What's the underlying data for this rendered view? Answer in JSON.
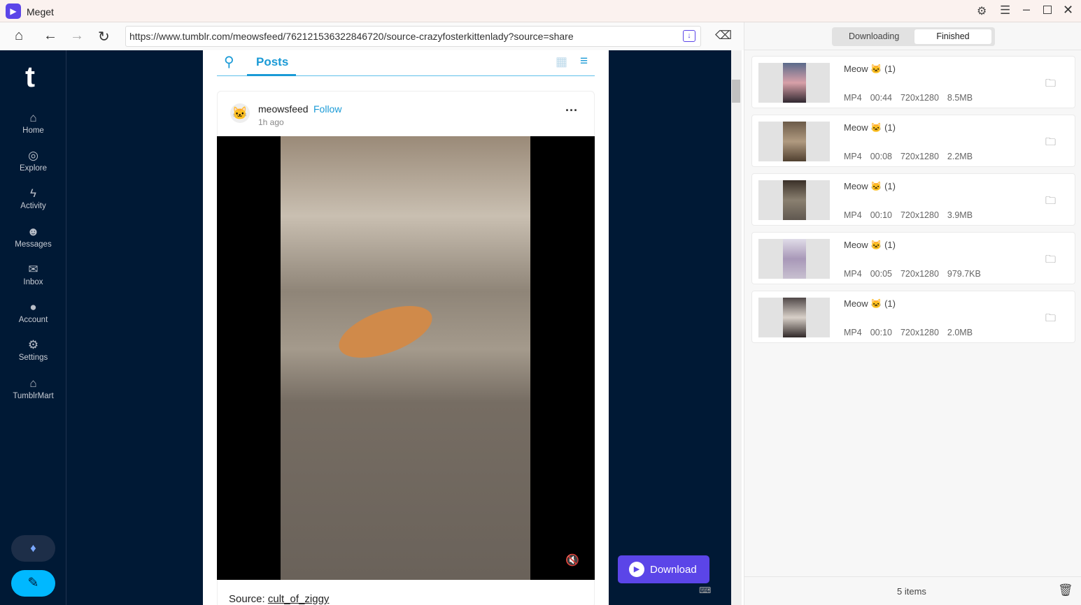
{
  "app": {
    "title": "Meget",
    "accent": "#5b45e8"
  },
  "toolbar": {
    "url": "https://www.tumblr.com/meowsfeed/762121536322846720/source-crazyfosterkittenlady?source=share"
  },
  "sidebar": {
    "logo": "t",
    "items": [
      {
        "label": "Home",
        "icon": "home-icon"
      },
      {
        "label": "Explore",
        "icon": "compass-icon"
      },
      {
        "label": "Activity",
        "icon": "bolt-icon"
      },
      {
        "label": "Messages",
        "icon": "smiley-icon"
      },
      {
        "label": "Inbox",
        "icon": "envelope-icon"
      },
      {
        "label": "Account",
        "icon": "person-icon"
      },
      {
        "label": "Settings",
        "icon": "gear-icon"
      },
      {
        "label": "TumblrMart",
        "icon": "store-icon"
      }
    ]
  },
  "feed": {
    "tab": "Posts",
    "post": {
      "author": "meowsfeed",
      "follow": "Follow",
      "time": "1h ago",
      "source_label": "Source:",
      "source_link": "cult_of_ziggy"
    }
  },
  "download_button": "Download",
  "panel": {
    "tabs": [
      "Downloading",
      "Finished"
    ],
    "active_tab": "Finished",
    "count": "5 items",
    "items": [
      {
        "title": "Meow 🐱 (1)",
        "format": "MP4",
        "duration": "00:44",
        "resolution": "720x1280",
        "size": "8.5MB"
      },
      {
        "title": "Meow 🐱 (1)",
        "format": "MP4",
        "duration": "00:08",
        "resolution": "720x1280",
        "size": "2.2MB"
      },
      {
        "title": "Meow 🐱 (1)",
        "format": "MP4",
        "duration": "00:10",
        "resolution": "720x1280",
        "size": "3.9MB"
      },
      {
        "title": "Meow 🐱 (1)",
        "format": "MP4",
        "duration": "00:05",
        "resolution": "720x1280",
        "size": "979.7KB"
      },
      {
        "title": "Meow 🐱 (1)",
        "format": "MP4",
        "duration": "00:10",
        "resolution": "720x1280",
        "size": "2.0MB"
      }
    ]
  }
}
